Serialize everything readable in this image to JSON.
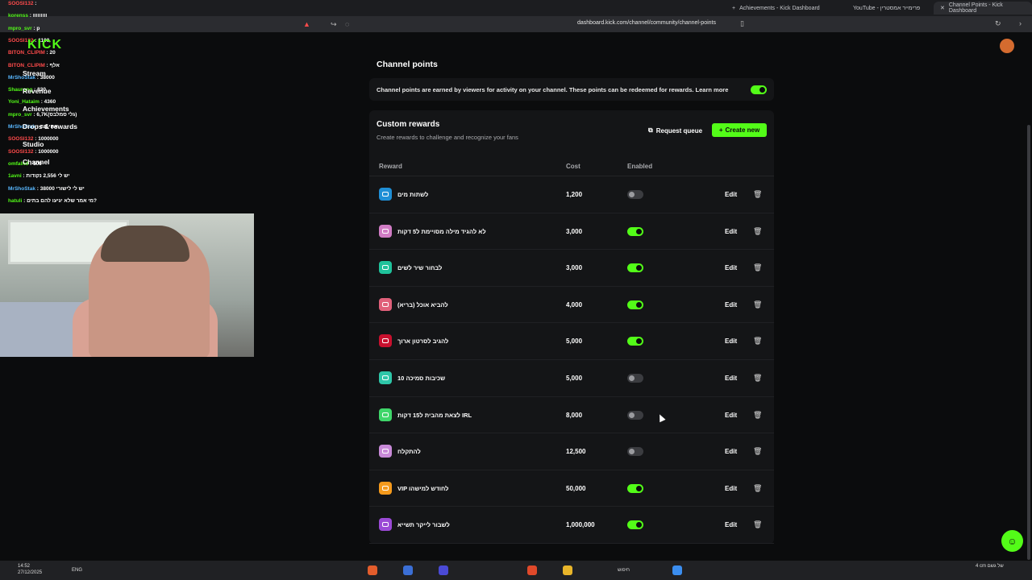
{
  "browser": {
    "tabs": [
      {
        "label": "Achievements - Kick Dashboard"
      },
      {
        "label": "YouTube - פרימייר אמסטרין"
      },
      {
        "label": "Channel Points - Kick Dashboard"
      }
    ],
    "url": "dashboard.kick.com/channel/community/channel-points"
  },
  "page": {
    "title": "Channel points",
    "info_text": "Channel points are earned by viewers for activity on your channel. These points can be redeemed for rewards. Learn more",
    "custom_rewards_title": "Custom rewards",
    "custom_rewards_subtitle": "Create rewards to challenge and recognize your fans",
    "request_queue": "Request queue",
    "create_new": "Create new",
    "col_reward": "Reward",
    "col_cost": "Cost",
    "col_enabled": "Enabled",
    "edit_label": "Edit"
  },
  "rewards": [
    {
      "name": "לשתות מים",
      "cost": "1,200",
      "enabled": false,
      "color": "#1f8fd6"
    },
    {
      "name": "לא להגיד מילה מסויימת ל5 דקות",
      "cost": "3,000",
      "enabled": true,
      "color": "#d07cc4"
    },
    {
      "name": "לבחור שיר לשים",
      "cost": "3,000",
      "enabled": true,
      "color": "#1fc29b"
    },
    {
      "name": "להביא אוכל (בריא)",
      "cost": "4,000",
      "enabled": true,
      "color": "#e0607a"
    },
    {
      "name": "להגיב לסרטון ארוך",
      "cost": "5,000",
      "enabled": true,
      "color": "#c8102e"
    },
    {
      "name": "10 שכיבות סמיכה",
      "cost": "5,000",
      "enabled": false,
      "color": "#2ec6a8"
    },
    {
      "name": "לצאת מהבית ל15 דקות IRL",
      "cost": "8,000",
      "enabled": false,
      "color": "#3fd66a"
    },
    {
      "name": "להתקלח",
      "cost": "12,500",
      "enabled": false,
      "color": "#c88ad8"
    },
    {
      "name": "VIP לחודש למישהו",
      "cost": "50,000",
      "enabled": true,
      "color": "#f59a1c"
    },
    {
      "name": "לשבור לייקר תשייא",
      "cost": "1,000,000",
      "enabled": true,
      "color": "#9b4ad6"
    }
  ],
  "overlay": {
    "logo": "KICK",
    "menu": [
      "Stream",
      "Revenue",
      "Achievements",
      "Drops & rewards",
      "Studio",
      "Channel"
    ],
    "chat": [
      {
        "user": "SOOSI132",
        "msg": "",
        "c": "r"
      },
      {
        "user": "korenss",
        "msg": "ווווווווו",
        "c": "g"
      },
      {
        "user": "mpro_svr",
        "msg": "p",
        "c": "g"
      },
      {
        "user": "SOOSI132",
        "msg": "1100",
        "c": "r"
      },
      {
        "user": "BITON_CLIPIM",
        "msg": "20",
        "c": "r"
      },
      {
        "user": "BITON_CLIPIM",
        "msg": "אלף",
        "c": "r"
      },
      {
        "user": "MrShoStak",
        "msg": "38000",
        "c": "b"
      },
      {
        "user": "Shaurong",
        "msg": "830",
        "c": "g"
      },
      {
        "user": "Yoni_Hataim",
        "msg": "4360",
        "c": "g"
      },
      {
        "user": "mpro_svr",
        "msg": "6,7K(גלי סמלבס)",
        "c": "g"
      },
      {
        "user": "MrShoStak",
        "msg": "אחי מה",
        "c": "b"
      },
      {
        "user": "SOOSI132",
        "msg": "1000000",
        "c": "r"
      },
      {
        "user": "SOOSI132",
        "msg": "1000000",
        "c": "r"
      },
      {
        "user": "omfalnd",
        "msg": "500",
        "c": "g"
      },
      {
        "user": "1avni",
        "msg": "יש לי 2,556 נקודות",
        "c": "g"
      },
      {
        "user": "MrShoStak",
        "msg": "יש לי לישורי 38000",
        "c": "b"
      },
      {
        "user": "hatuli",
        "msg": "מי אמר שלא יגיעו להם בתים?",
        "c": "g"
      }
    ]
  },
  "taskbar": {
    "time": "14:52",
    "date": "27/12/2025",
    "lang": "ENG",
    "search": "חיפוש",
    "weather": "4 cm של גשם"
  }
}
